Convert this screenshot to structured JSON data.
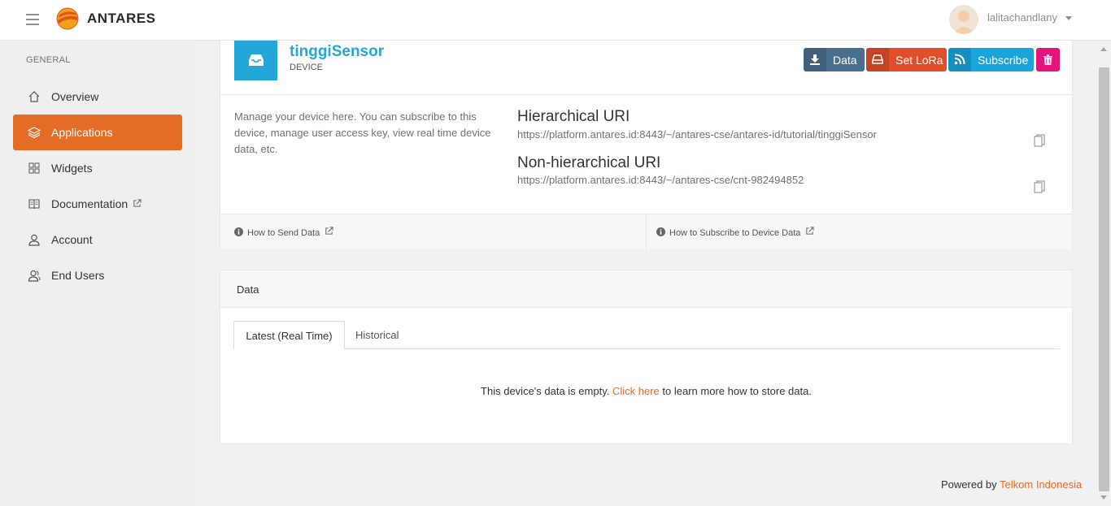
{
  "header": {
    "brand": "ANTARES",
    "username": "lalitachandlany"
  },
  "sidebar": {
    "heading": "GENERAL",
    "items": [
      {
        "label": "Overview",
        "icon": "home-icon"
      },
      {
        "label": "Applications",
        "icon": "layers-icon",
        "active": true
      },
      {
        "label": "Widgets",
        "icon": "grid-icon"
      },
      {
        "label": "Documentation",
        "icon": "book-icon",
        "external": true
      },
      {
        "label": "Account",
        "icon": "user-icon"
      },
      {
        "label": "End Users",
        "icon": "users-icon"
      }
    ]
  },
  "device": {
    "name": "tinggiSensor",
    "type": "DEVICE",
    "description": "Manage your device here. You can subscribe to this device, manage user access key, view real time device data, etc.",
    "buttons": {
      "data": "Data",
      "set_lora": "Set LoRa",
      "subscribe": "Subscribe"
    },
    "hierarchical_title": "Hierarchical URI",
    "hierarchical_uri": "https://platform.antares.id:8443/~/antares-cse/antares-id/tutorial/tinggiSensor",
    "nonhierarchical_title": "Non-hierarchical URI",
    "nonhierarchical_uri": "https://platform.antares.id:8443/~/antares-cse/cnt-982494852",
    "help_send": "How to Send Data",
    "help_subscribe": "How to Subscribe to Device Data"
  },
  "data_panel": {
    "title": "Data",
    "tabs": [
      "Latest (Real Time)",
      "Historical"
    ],
    "empty_before": "This device's data is empty.",
    "empty_link": "Click here",
    "empty_after": "to learn more how to store data."
  },
  "footer": {
    "prefix": "Powered by",
    "link": "Telkom Indonesia"
  },
  "colors": {
    "accent": "#e56c24",
    "device_blue": "#24a6d9",
    "btn_data": "#4a6f8e",
    "btn_lora": "#e04e2a",
    "btn_subscribe": "#19a5dc",
    "btn_delete": "#e5147c"
  }
}
